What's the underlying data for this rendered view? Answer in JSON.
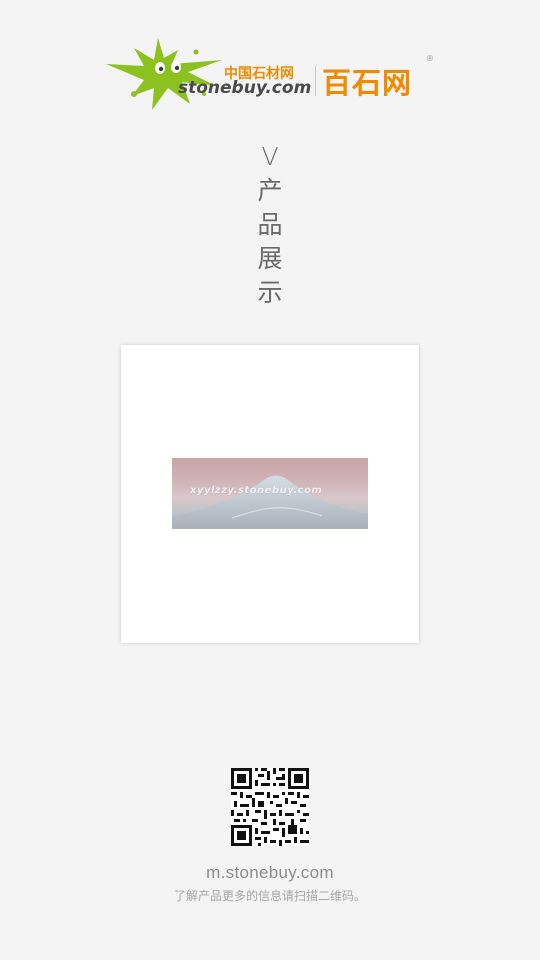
{
  "header": {
    "logo_cn_small": "中国石材网",
    "logo_domain": "stonebuy.com",
    "logo_brand": "百石网",
    "logo_registered": "®",
    "logo_icon": "green-star-splash-icon",
    "colors": {
      "logo_green": "#8cc21f",
      "logo_orange": "#f08a00"
    }
  },
  "section": {
    "title_chars": [
      "V",
      "产",
      "品",
      "展",
      "示"
    ]
  },
  "product": {
    "image_watermark": "xyylzzy.stonebuy.com"
  },
  "footer": {
    "qr_icon": "qr-code-icon",
    "site_url": "m.stonebuy.com",
    "scan_hint": "了解产品更多的信息请扫描二维码。"
  }
}
